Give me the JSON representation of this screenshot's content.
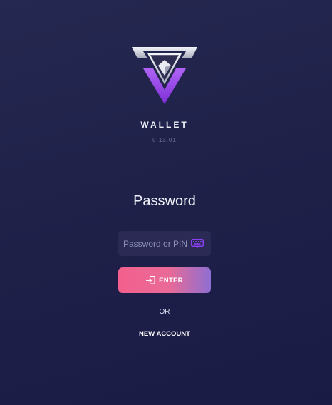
{
  "app": {
    "name": "WALLET",
    "version": "0.13.01",
    "logo_icon": "wallet-logo-icon"
  },
  "login": {
    "title": "Password",
    "password_placeholder": "Password or PIN",
    "password_value": "",
    "keyboard_icon": "keyboard-icon",
    "enter_icon": "sign-in-icon",
    "enter_label": "ENTER",
    "divider_label": "OR",
    "new_account_label": "NEW ACCOUNT"
  },
  "colors": {
    "background": "#1f2149",
    "accent_pink": "#f3608d",
    "accent_purple": "#8e6fd2",
    "logo_purple": "#9b45e8",
    "keyboard_icon": "#8a3ff0"
  }
}
